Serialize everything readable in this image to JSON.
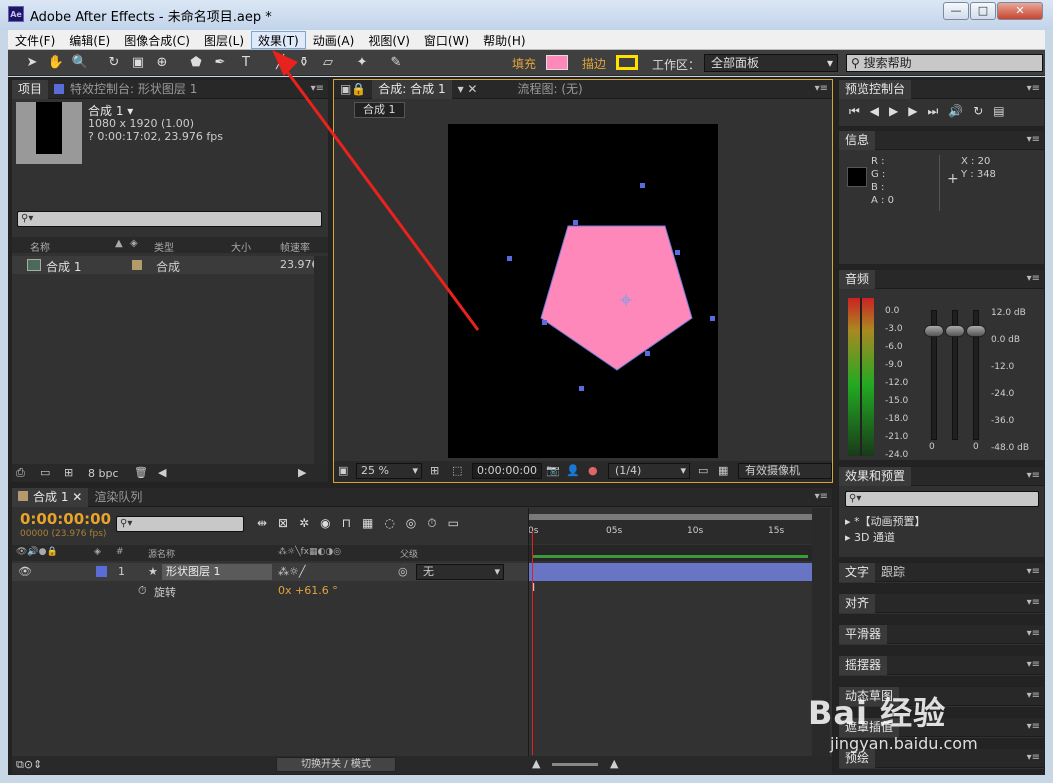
{
  "window": {
    "title": "Adobe After Effects - 未命名项目.aep *",
    "app_icon": "Ae",
    "min": "—",
    "max": "□",
    "close": "✕"
  },
  "menu": [
    "文件(F)",
    "编辑(E)",
    "图像合成(C)",
    "图层(L)",
    "效果(T)",
    "动画(A)",
    "视图(V)",
    "窗口(W)",
    "帮助(H)"
  ],
  "toolbar": {
    "fill_label": "填充",
    "stroke_label": "描边",
    "workspace_label": "工作区：",
    "workspace_value": "全部面板",
    "search_help": "搜索帮助",
    "fill_color": "#ff88bb",
    "stroke_color": "#ffe000"
  },
  "project": {
    "tab": "项目",
    "effect_tab": "特效控制台: 形状图层 1",
    "comp_name": "合成 1 ▾",
    "comp_size": "1080 x 1920 (1.00)",
    "comp_duration": "? 0:00:17:02, 23.976 fps",
    "col_name": "名称",
    "col_type": "类型",
    "col_size": "大小",
    "col_fps": "帧速率",
    "item_name": "合成 1",
    "item_type": "合成",
    "item_fps": "23.976",
    "bpc": "8 bpc"
  },
  "viewer": {
    "tab": "合成: 合成 1",
    "flow_tab": "流程图: (无)",
    "comp_button": "合成 1",
    "zoom": "25 %",
    "timecode": "0:00:00:00",
    "resolution": "(1/4)",
    "camera": "有效摄像机"
  },
  "preview": {
    "tab": "预览控制台"
  },
  "info": {
    "tab": "信息",
    "r": "R :",
    "g": "G :",
    "b": "B :",
    "a": "A : 0",
    "x": "X : 20",
    "y": "Y : 348"
  },
  "audio": {
    "tab": "音频",
    "left": [
      "0.0",
      "-3.0",
      "-6.0",
      "-9.0",
      "-12.0",
      "-15.0",
      "-18.0",
      "-21.0",
      "-24.0"
    ],
    "right": [
      "12.0 dB",
      "0.0 dB",
      "-12.0",
      "-24.0",
      "-36.0",
      "-48.0 dB"
    ],
    "zero1": "0",
    "zero2": "0"
  },
  "effects": {
    "tab": "效果和预置",
    "item1": "▸ *【动画预置】",
    "item2": "▸ 3D 通道"
  },
  "side_panels": {
    "text": "文字",
    "paragraph": "跟踪",
    "align": "对齐",
    "smoother": "平滑器",
    "wiggler": "摇摆器",
    "motion_sketch": "动态草图",
    "mask": "遮罩插值",
    "brush": "预绘"
  },
  "timeline": {
    "tab": "合成 1",
    "render_tab": "渲染队列",
    "timecode": "0:00:00:00",
    "fps": "00000 (23.976 fps)",
    "col_num": "#",
    "col_source": "源名称",
    "col_parent": "父级",
    "layer_num": "1",
    "layer_name": "形状图层 1",
    "parent_value": "无",
    "prop_name": "旋转",
    "prop_value": "0x +61.6 °",
    "ticks": [
      "0s",
      "05s",
      "10s",
      "15s"
    ],
    "switch_mode": "切换开关 / 模式"
  },
  "watermark": {
    "brand": "Bai 经验",
    "url": "jingyan.baidu.com"
  }
}
